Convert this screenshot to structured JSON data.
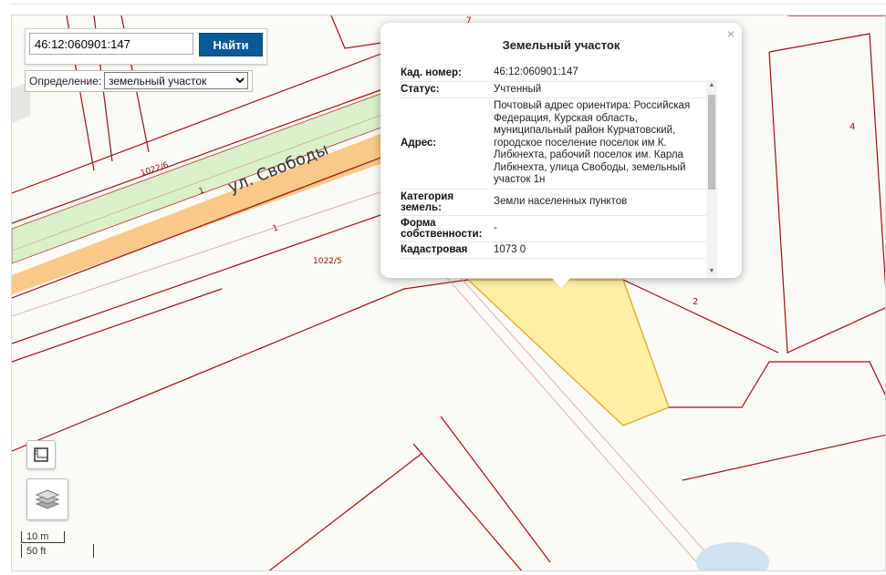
{
  "search": {
    "value": "46:12:060901:147",
    "button": "Найти"
  },
  "definition": {
    "label": "Определение:",
    "selected": "земельный участок"
  },
  "map": {
    "street_label": "ул. Свободы",
    "parcel_labels": [
      "1022/6",
      "1022/5",
      "1",
      "1"
    ],
    "numbers": [
      "4",
      "2",
      "7"
    ]
  },
  "popup": {
    "title": "Земельный участок",
    "close": "×",
    "rows": [
      {
        "key": "Кад. номер:",
        "value": "46:12:060901:147"
      },
      {
        "key": "Статус:",
        "value": "Учтенный"
      },
      {
        "key": "Адрес:",
        "value": "Почтовый адрес ориентира: Российская Федерация, Курская область, муниципальный район Курчатовский, городское поселение поселок им К. Либкнехта, рабочий поселок им. Карла Либкнехта, улица Свободы, земельный участок 1н"
      },
      {
        "key": "Категория земель:",
        "value": "Земли населенных пунктов"
      },
      {
        "key": "Форма собственности:",
        "value": "-"
      },
      {
        "key": "Кадастровая",
        "value": "1073 0 "
      }
    ]
  },
  "scale": {
    "metric": "10 m",
    "imperial": "50 ft"
  },
  "icons": {
    "ruler": "ruler-icon",
    "layers": "layers-icon"
  },
  "colors": {
    "button": "#0b5a96",
    "parcel_line": "#a01010",
    "road": "#f9c98a",
    "green": "#d9f0c8",
    "selected_parcel": "#fff0a8"
  }
}
